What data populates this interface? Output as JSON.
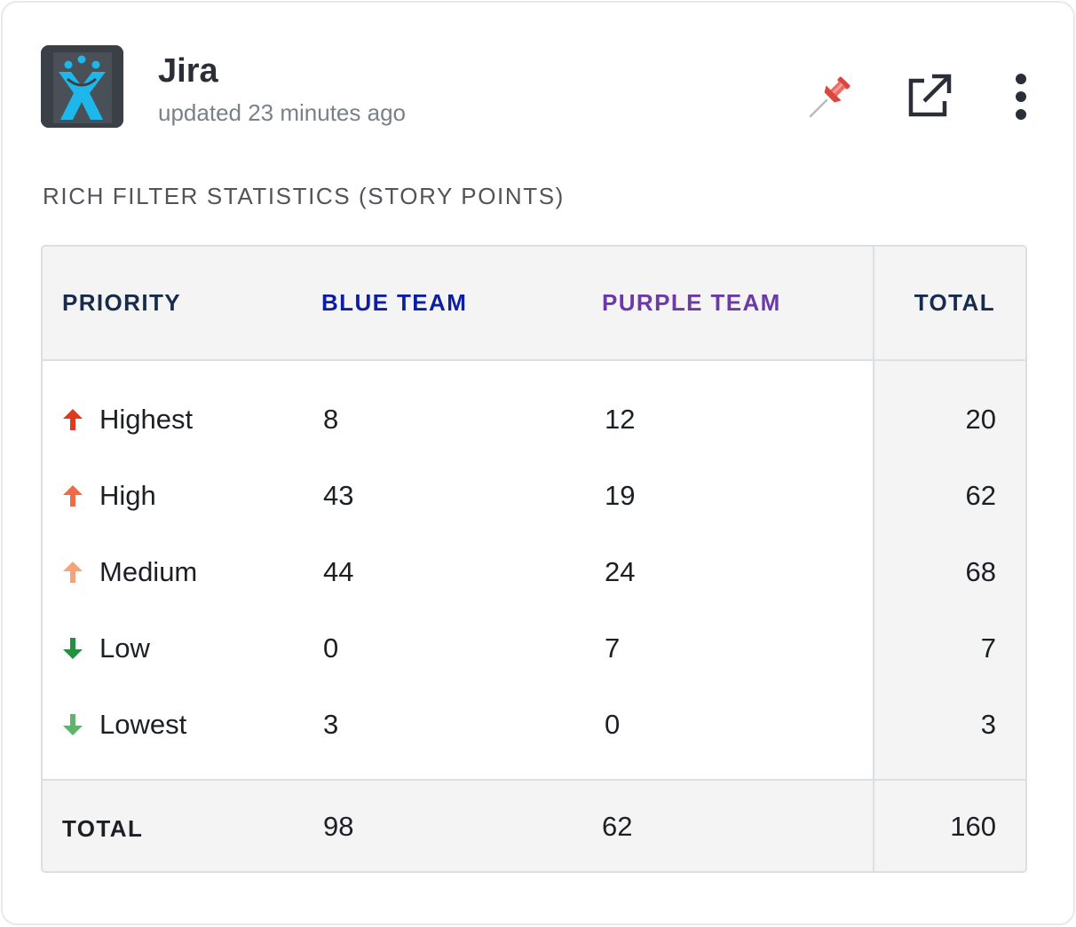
{
  "header": {
    "app_name": "Jira",
    "updated_text": "updated 23 minutes ago",
    "logo_icon": "jira-logo-icon",
    "actions": [
      {
        "icon": "pin-icon",
        "color": "#e5534b"
      },
      {
        "icon": "open-external-icon",
        "color": "#2a2f37"
      },
      {
        "icon": "more-vertical-icon",
        "color": "#2a2f37"
      }
    ]
  },
  "section_title": "RICH FILTER STATISTICS (STORY POINTS)",
  "table": {
    "columns": [
      {
        "label": "PRIORITY",
        "color": "#1c1f24"
      },
      {
        "label": "BLUE TEAM",
        "color": "#0b1ea5"
      },
      {
        "label": "PURPLE TEAM",
        "color": "#6b3aa8"
      },
      {
        "label": "TOTAL",
        "color": "#1c1f24"
      }
    ],
    "rows": [
      {
        "priority": "Highest",
        "icon": "arrow-up-icon",
        "icon_color": "#e03a1e",
        "blue": "8",
        "purple": "12",
        "total": "20"
      },
      {
        "priority": "High",
        "icon": "arrow-up-icon",
        "icon_color": "#f06b45",
        "blue": "43",
        "purple": "19",
        "total": "62"
      },
      {
        "priority": "Medium",
        "icon": "arrow-up-icon",
        "icon_color": "#f5a47a",
        "blue": "44",
        "purple": "24",
        "total": "68"
      },
      {
        "priority": "Low",
        "icon": "arrow-down-icon",
        "icon_color": "#23903f",
        "blue": "0",
        "purple": "7",
        "total": "7"
      },
      {
        "priority": "Lowest",
        "icon": "arrow-down-icon",
        "icon_color": "#5fb36b",
        "blue": "3",
        "purple": "0",
        "total": "3"
      }
    ],
    "footer": {
      "label": "TOTAL",
      "blue": "98",
      "purple": "62",
      "total": "160"
    }
  }
}
